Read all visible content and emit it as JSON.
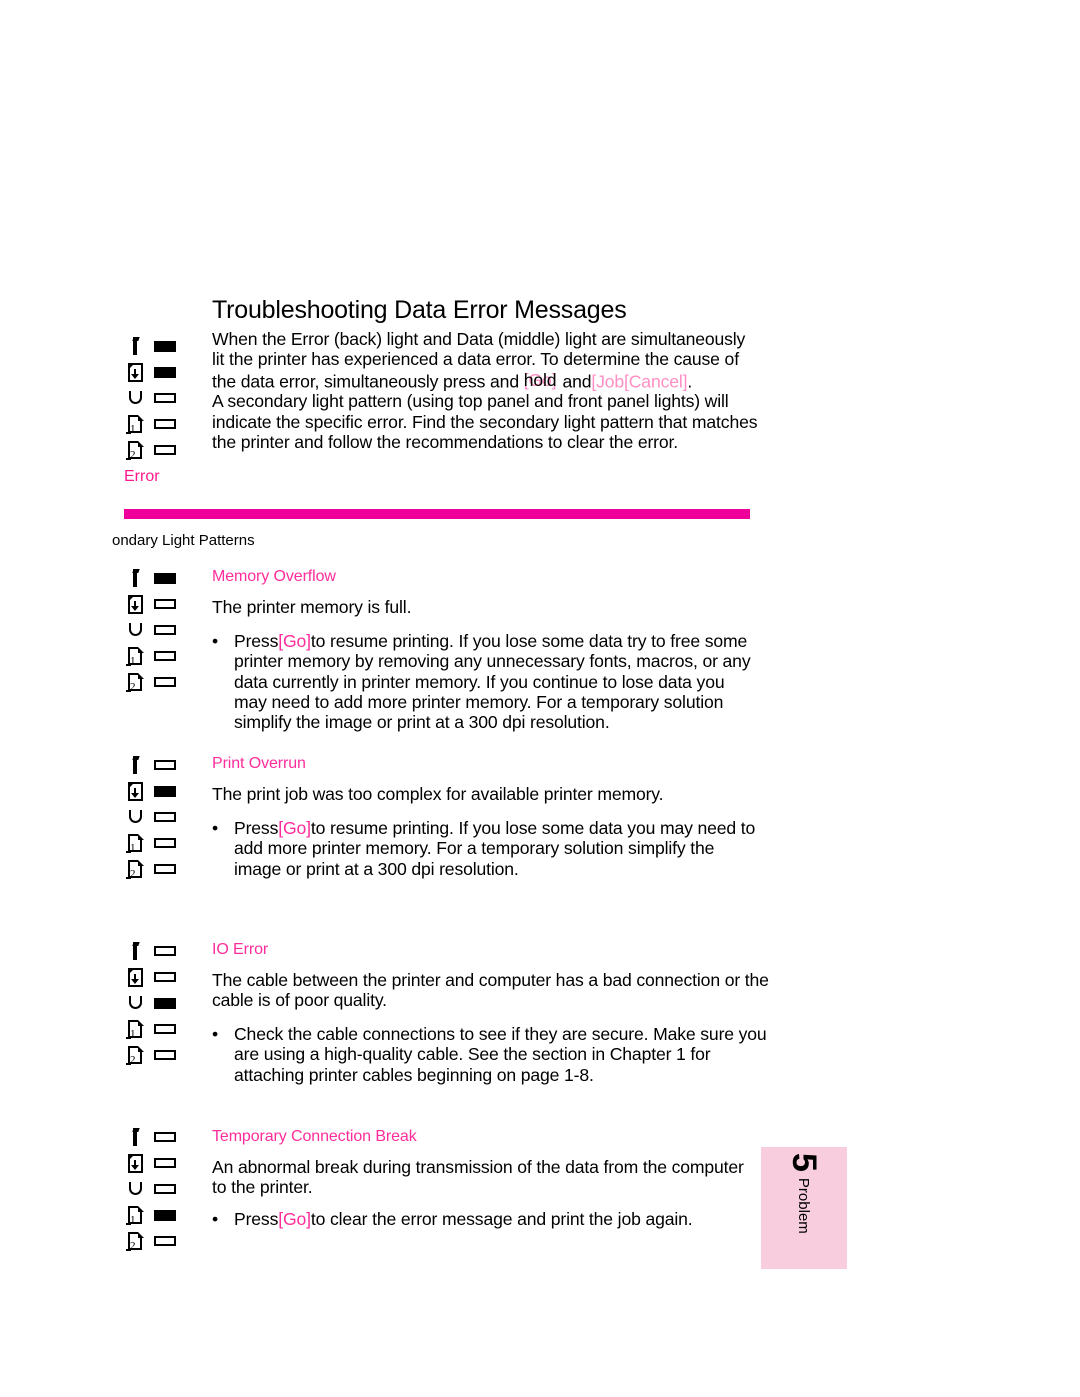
{
  "page": {
    "title": "Troubleshooting Data Error Messages",
    "intro": {
      "line1": "When the Error (back) light and Data (middle) light are simultaneously",
      "line2": "lit the printer has experienced a data error. To determine the cause of",
      "line3_a": "the data error, simultaneously press and ",
      "line3_overlap_under": "[Go]",
      "line3_overlap_over": "hold",
      "line3_b": " and",
      "line3_c": "[Job[Cancel]",
      "line3_d": ".",
      "line4": "A secondary light pattern (using top panel and front panel lights) will",
      "line5": "indicate the specific error. Find the secondary light pattern that matches",
      "line6": "the printer and follow the recommendations to clear the error."
    },
    "error_caption": "Error",
    "clipped_caption": "ondary Light Patterns",
    "rule_color": "#f0009b",
    "accent_color": "#ff2d9b",
    "tab": {
      "number": "5",
      "label": "Problem",
      "bg_color": "#f8cede"
    }
  },
  "light_glyphs": [
    {
      "name": "toner-bar-icon",
      "type": "toner"
    },
    {
      "name": "paper-feed-icon",
      "type": "feed"
    },
    {
      "name": "drum-u-icon",
      "type": "u"
    },
    {
      "name": "tray-1-page-icon",
      "type": "page",
      "digit": "1"
    },
    {
      "name": "tray-2-page-icon",
      "type": "page",
      "digit": "2"
    }
  ],
  "patterns": {
    "intro": [
      true,
      true,
      false,
      false,
      false
    ],
    "memory_overflow": [
      true,
      false,
      false,
      false,
      false
    ],
    "print_overrun": [
      false,
      true,
      false,
      false,
      false
    ],
    "io_error": [
      false,
      false,
      true,
      false,
      false
    ],
    "temporary_connection_break": [
      false,
      false,
      false,
      true,
      false
    ]
  },
  "sections": [
    {
      "heading": "Memory Overflow",
      "body": "The printer memory is full.",
      "bullet": {
        "press": "Press",
        "go": "[Go]",
        "rest_line1": "to resume printing. If you lose some data try to free some",
        "rest_line2": "printer memory by removing any unnecessary fonts, macros, or any",
        "rest_line3": "data currently in printer memory. If you continue to lose data you",
        "rest_line4": "may need to add more printer memory. For a temporary solution",
        "rest_line5": "simplify the image or print at a 300 dpi resolution."
      }
    },
    {
      "heading": "Print Overrun",
      "body": "The print job was too complex for available printer memory.",
      "bullet": {
        "press": "Press",
        "go": "[Go]",
        "rest_line1": "to resume printing. If you lose some data you may need to",
        "rest_line2": "add more printer memory. For a temporary solution simplify the",
        "rest_line3": "image or print at a 300 dpi resolution."
      }
    },
    {
      "heading": "IO Error",
      "body_line1": "The cable between the printer and computer has a bad connection or the",
      "body_line2": "cable is of poor quality.",
      "bullet": {
        "rest_line1": "Check the cable connections to see if they are secure. Make sure you",
        "rest_line2": "are using a high-quality cable. See the section in Chapter 1 for",
        "rest_line3": "attaching printer cables beginning on page 1-8."
      }
    },
    {
      "heading": "Temporary Connection Break",
      "body_line1": "An abnormal break during transmission of the data from the computer",
      "body_line2": "to the printer.",
      "bullet": {
        "press": "Press",
        "go": "[Go]",
        "rest_line1": "to clear the error message and print the job again."
      }
    }
  ]
}
